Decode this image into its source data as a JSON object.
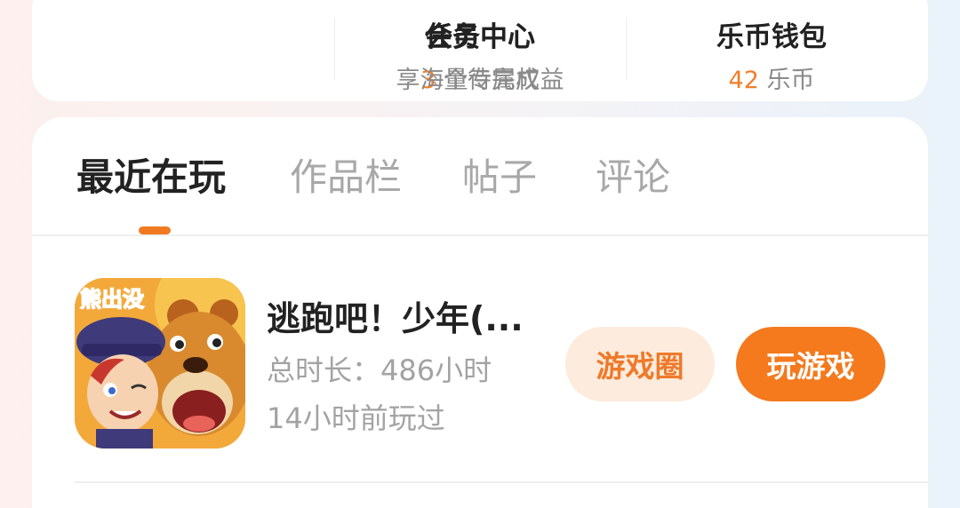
{
  "top_menu": [
    {
      "title": "任务中心",
      "value": "3",
      "suffix": " 个待完成"
    },
    {
      "title": "会员中心",
      "subtitle": "享海量专属权益"
    },
    {
      "title": "乐币钱包",
      "value": "42",
      "suffix": " 乐币"
    }
  ],
  "tabs": [
    "最近在玩",
    "作品栏",
    "帖子",
    "评论"
  ],
  "active_tab": "最近在玩",
  "game": {
    "icon_text": "熊出没",
    "title": "逃跑吧！少年(...",
    "total_time": "总时长：486小时",
    "last_played": "14小时前玩过",
    "circle_button": "游戏圈",
    "play_button": "玩游戏"
  },
  "colors": {
    "accent": "#f47a1d",
    "accent_light": "#fdebdd",
    "number": "#ef7f2a"
  }
}
